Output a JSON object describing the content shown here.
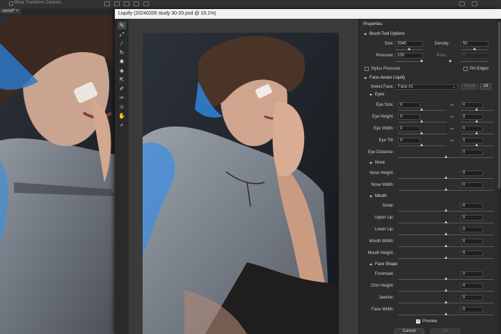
{
  "background": {
    "option_label": "Show Transform Controls",
    "tab_label": "saved* ×"
  },
  "dialog": {
    "title": "Liquify (20240205 study 30-20.psd @ 19.1%)"
  },
  "tools": [
    "forward-warp",
    "reconstruct",
    "smooth",
    "twirl",
    "pucker",
    "bloat",
    "push-left",
    "freeze-mask",
    "thaw-mask",
    "face",
    "hand",
    "zoom"
  ],
  "properties": {
    "title": "Properties",
    "brush": {
      "title": "Brush Tool Options",
      "size_label": "Size:",
      "size_value": "3340",
      "density_label": "Density:",
      "density_value": "50",
      "pressure_label": "Pressure:",
      "pressure_value": "100",
      "rate_label": "Rate:",
      "rate_value": "0",
      "stylus_label": "Stylus Pressure",
      "pin_label": "Pin Edges"
    },
    "face": {
      "title": "Face-Aware Liquify",
      "select_label": "Select Face:",
      "select_value": "Face #1",
      "reset_label": "Reset",
      "all_label": "All"
    },
    "eyes": {
      "title": "Eyes",
      "size": {
        "label": "Eye Size:",
        "left": "0",
        "right": "0"
      },
      "height": {
        "label": "Eye Height:",
        "left": "0",
        "right": "0"
      },
      "width": {
        "label": "Eye Width:",
        "left": "0",
        "right": "0"
      },
      "tilt": {
        "label": "Eye Tilt:",
        "left": "0",
        "right": "0"
      },
      "distance": {
        "label": "Eye Distance:",
        "value": "0"
      }
    },
    "nose": {
      "title": "Nose",
      "height": {
        "label": "Nose Height:",
        "value": "0"
      },
      "width": {
        "label": "Nose Width:",
        "value": "0"
      }
    },
    "mouth": {
      "title": "Mouth",
      "smile": {
        "label": "Smile:",
        "value": "0"
      },
      "upper": {
        "label": "Upper Lip:",
        "value": "0"
      },
      "lower": {
        "label": "Lower Lip:",
        "value": "0"
      },
      "width": {
        "label": "Mouth Width:",
        "value": "0"
      },
      "height": {
        "label": "Mouth Height:",
        "value": "0"
      }
    },
    "shape": {
      "title": "Face Shape",
      "forehead": {
        "label": "Forehead:",
        "value": "0"
      },
      "chin": {
        "label": "Chin Height:",
        "value": "0"
      },
      "jaw": {
        "label": "Jawline:",
        "value": "0"
      },
      "fwidth": {
        "label": "Face Width:",
        "value": "0"
      }
    },
    "preview_label": "Preview",
    "cancel_label": "Cancel",
    "ok_label": "OK"
  }
}
